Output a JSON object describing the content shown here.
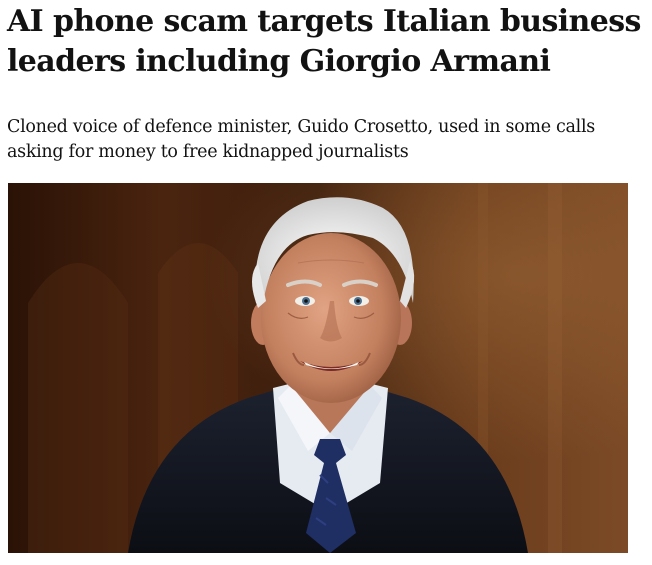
{
  "article": {
    "headline": "AI phone scam targets Italian business leaders including Giorgio Armani",
    "standfirst": "Cloned voice of defence minister, Guido Crosetto, used in some calls asking for money to free kidnapped journalists",
    "image": {
      "subject": "portrait-photo"
    }
  },
  "colors": {
    "background": "#ffffff",
    "text": "#121212",
    "photo_backdrop": "#3a1d0c",
    "jacket": "#151922",
    "shirt": "#e6ebf2",
    "tie": "#1f2e63",
    "hair": "#e9e9e9",
    "skin": "#c88a6a"
  }
}
